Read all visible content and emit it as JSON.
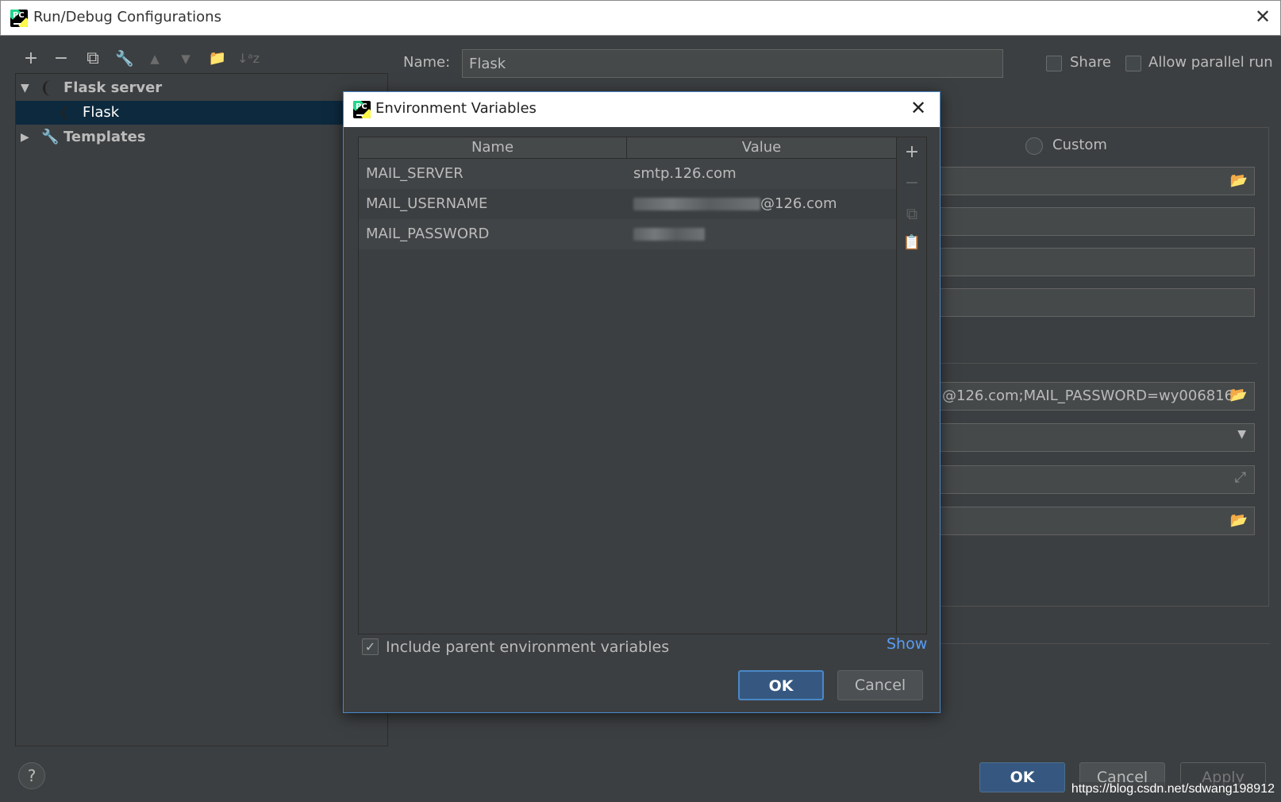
{
  "window": {
    "title": "Run/Debug Configurations",
    "close_glyph": "✕",
    "logo_text": "PC"
  },
  "toolbar": {
    "add": "+",
    "remove": "−",
    "copy": "⧉",
    "edit": "🔧",
    "up": "▲",
    "down": "▼",
    "folder": "📁",
    "sort": "↓ᵃz"
  },
  "tree": {
    "items": [
      {
        "label": "Flask server",
        "icon": "flask-icon",
        "expanded": true
      },
      {
        "label": "Flask",
        "icon": "flask-icon",
        "selected": true
      },
      {
        "label": "Templates",
        "icon": "wrench-icon",
        "expanded": false
      }
    ]
  },
  "config": {
    "name_label": "Name:",
    "name_value": "Flask",
    "share_label": "Share",
    "parallel_label": "Allow parallel run",
    "custom_label": "Custom",
    "env_field_value": "@126.com;MAIL_PASSWORD=wy006816"
  },
  "footer": {
    "ok": "OK",
    "cancel": "Cancel",
    "apply": "Apply",
    "help": "?",
    "watermark": "https://blog.csdn.net/sdwang198912"
  },
  "dialog": {
    "title": "Environment Variables",
    "close_glyph": "✕",
    "columns": [
      "Name",
      "Value"
    ],
    "rows": [
      {
        "name": "MAIL_SERVER",
        "value": "smtp.126.com",
        "redacted": false
      },
      {
        "name": "MAIL_USERNAME",
        "value": "@126.com",
        "redacted": true
      },
      {
        "name": "MAIL_PASSWORD",
        "value": "",
        "redacted": true
      }
    ],
    "include_parent_label": "Include parent environment variables",
    "include_parent_checked": true,
    "show_link": "Show",
    "ok": "OK",
    "cancel": "Cancel"
  },
  "colors": {
    "background": "#3c3f41",
    "selection": "#0d293e",
    "default_button": "#365880",
    "link": "#589df6",
    "dialog_border": "#4a88c7"
  }
}
